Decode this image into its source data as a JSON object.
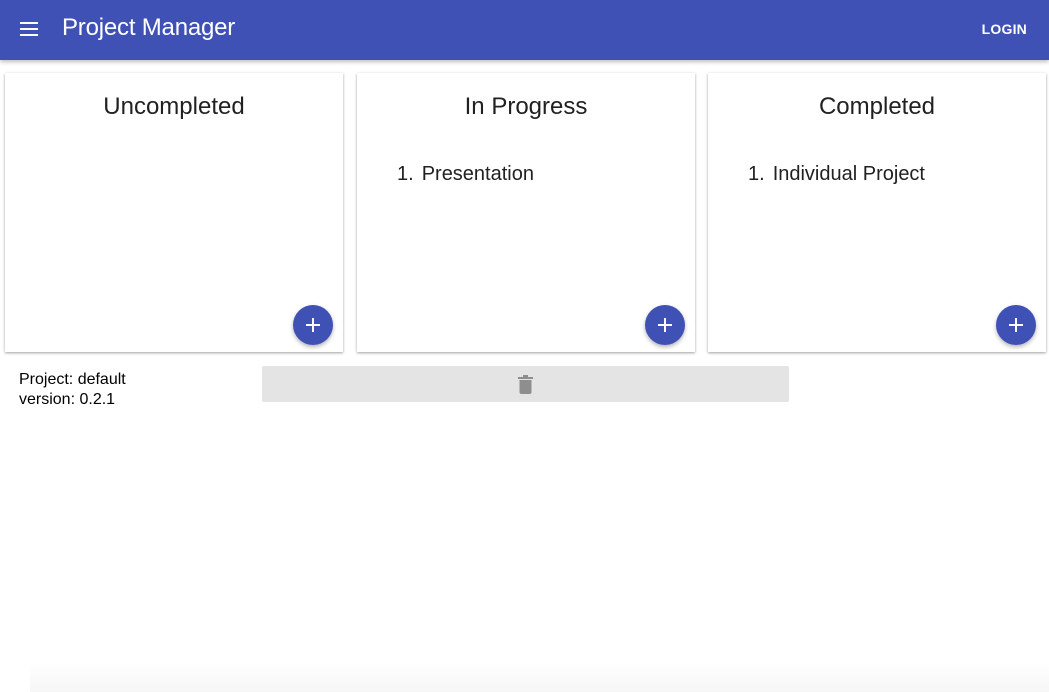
{
  "appbar": {
    "title": "Project Manager",
    "menu_icon": "menu-icon",
    "login_label": "LOGIN",
    "color": "#3f51b5"
  },
  "columns": [
    {
      "title": "Uncompleted",
      "tasks": [],
      "add_icon": "plus-icon"
    },
    {
      "title": "In Progress",
      "tasks": [
        {
          "index": "1.",
          "name": "Presentation"
        }
      ],
      "add_icon": "plus-icon"
    },
    {
      "title": "Completed",
      "tasks": [
        {
          "index": "1.",
          "name": "Individual Project"
        }
      ],
      "add_icon": "plus-icon"
    }
  ],
  "footer": {
    "project_line": "Project: default",
    "version_line": "version: 0.2.1",
    "delete_icon": "trash-icon"
  }
}
